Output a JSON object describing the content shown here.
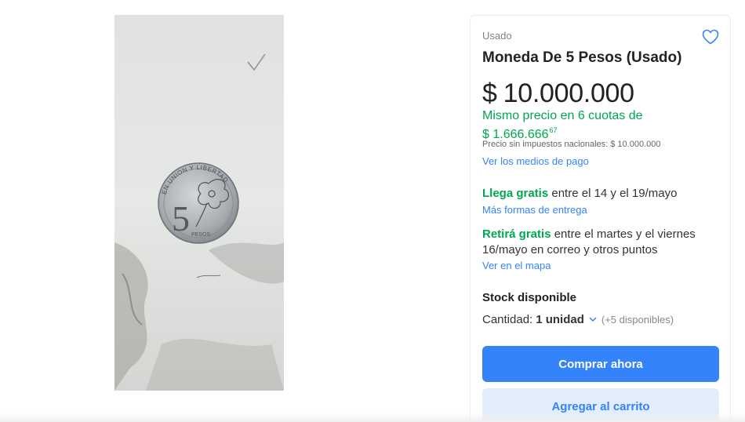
{
  "product": {
    "condition": "Usado",
    "title": "Moneda De 5 Pesos (Usado)",
    "price_currency": "$",
    "price_amount": "10.000.000",
    "installments_line1": "Mismo precio en 6 cuotas de",
    "installments_amount": "$ 1.666.666",
    "installments_cents": "67",
    "tax_note": "Precio sin impuestos nacionales: $ 10.000.000",
    "payment_link": "Ver los medios de pago"
  },
  "shipping": {
    "free_label": "Llega gratis",
    "dates": " entre el 14 y el 19/mayo",
    "more_link": "Más formas de entrega"
  },
  "pickup": {
    "free_label": "Retirá gratis",
    "text": " entre el martes y el viernes 16/mayo en correo y otros puntos",
    "map_link": "Ver en el mapa"
  },
  "stock": {
    "title": "Stock disponible",
    "qty_label": "Cantidad:",
    "qty_value": "1 unidad",
    "available": "(+5 disponibles)"
  },
  "actions": {
    "buy_label": "Comprar ahora",
    "cart_label": "Agregar al carrito"
  },
  "coin": {
    "top_text": "EN UNION Y LIBERTAD",
    "denomination": "5",
    "unit": "PESOS"
  },
  "colors": {
    "accent": "#3483fa",
    "green": "#00a650",
    "cart_bg": "#e3edfb"
  },
  "icons": {
    "favorite": "heart-outline-icon",
    "quantity": "chevron-down-icon"
  }
}
